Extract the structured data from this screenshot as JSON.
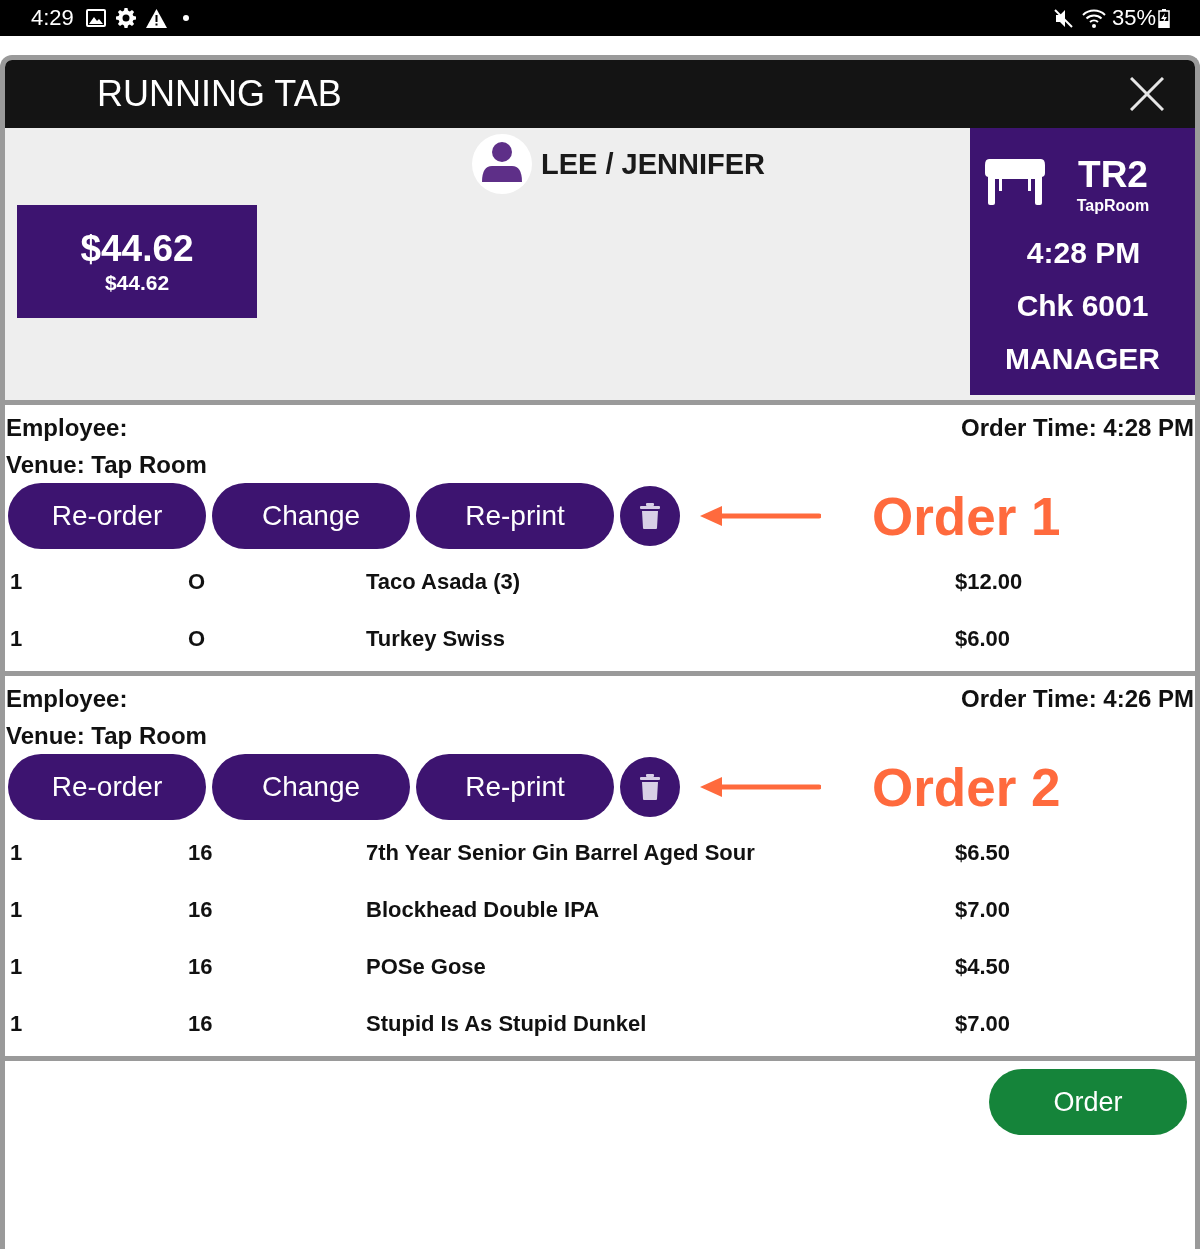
{
  "status_bar": {
    "time": "4:29",
    "battery": "35%"
  },
  "dialog": {
    "title": "RUNNING TAB"
  },
  "summary": {
    "total": "$44.62",
    "subtotal": "$44.62",
    "customer": "LEE / JENNIFER",
    "table": "TR2",
    "area": "TapRoom",
    "time": "4:28 PM",
    "check": "Chk 6001",
    "role": "MANAGER"
  },
  "orders": [
    {
      "employee": "Employee:",
      "order_time": "Order Time: 4:28 PM",
      "venue": "Venue: Tap Room",
      "actions": [
        "Re-order",
        "Change",
        "Re-print"
      ],
      "annotation": "Order 1",
      "items": [
        {
          "qty": "1",
          "column_2": "O",
          "name": "Taco Asada (3)",
          "price": "$12.00"
        },
        {
          "qty": "1",
          "column_2": "O",
          "name": "Turkey Swiss",
          "price": "$6.00"
        }
      ]
    },
    {
      "employee": "Employee:",
      "order_time": "Order Time: 4:26 PM",
      "venue": "Venue: Tap Room",
      "actions": [
        "Re-order",
        "Change",
        "Re-print"
      ],
      "annotation": "Order 2",
      "items": [
        {
          "qty": "1",
          "column_2": "16",
          "name": "7th Year Senior Gin Barrel Aged Sour",
          "price": "$6.50"
        },
        {
          "qty": "1",
          "column_2": "16",
          "name": "Blockhead Double IPA",
          "price": "$7.00"
        },
        {
          "qty": "1",
          "column_2": "16",
          "name": "POSe Gose",
          "price": "$4.50"
        },
        {
          "qty": "1",
          "column_2": "16",
          "name": "Stupid Is As Stupid Dunkel",
          "price": "$7.00"
        }
      ]
    }
  ],
  "footer": {
    "order_button": "Order"
  }
}
